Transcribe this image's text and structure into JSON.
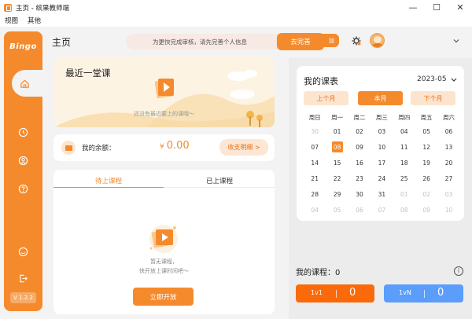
{
  "window": {
    "title": "主页 - 缤果教师端",
    "minimize": "—",
    "maximize": "☐",
    "close": "✕"
  },
  "menu": [
    "视图",
    "其他"
  ],
  "sidebar": {
    "logo": "Bingo",
    "version": "V 1.2.2"
  },
  "header": {
    "title": "主页",
    "notice": "为更快完成审核，请先完善个人信息",
    "notice_button": "去完善",
    "notice_tail": "加"
  },
  "recent": {
    "title": "最近一堂课",
    "empty_text": "还没有最近要上的课哦～"
  },
  "balance": {
    "label": "我的余额：",
    "currency": "¥",
    "value": "0.00",
    "ledger_button": "收支明细 >"
  },
  "courses": {
    "tabs": [
      "待上课程",
      "已上课程"
    ],
    "empty_line1": "暂无课程，",
    "empty_line2": "快开放上课时间吧～",
    "open_button": "立即开放"
  },
  "calendar": {
    "title": "我的课表",
    "month": "2023-05",
    "prev": "上个月",
    "current": "本月",
    "next": "下个月",
    "weekdays": [
      "周日",
      "周一",
      "周二",
      "周三",
      "周四",
      "周五",
      "周六"
    ],
    "weeks": [
      [
        "30",
        "01",
        "02",
        "03",
        "04",
        "05",
        "06"
      ],
      [
        "07",
        "08",
        "09",
        "10",
        "11",
        "12",
        "13"
      ],
      [
        "14",
        "15",
        "16",
        "17",
        "18",
        "19",
        "20"
      ],
      [
        "21",
        "22",
        "23",
        "24",
        "25",
        "26",
        "27"
      ],
      [
        "28",
        "29",
        "30",
        "31",
        "01",
        "02",
        "03"
      ],
      [
        "04",
        "05",
        "06",
        "07",
        "08",
        "09",
        "10"
      ]
    ],
    "today": "08"
  },
  "mycourse": {
    "label": "我的课程：",
    "count": "0",
    "stats": [
      {
        "label": "1v1",
        "value": "0",
        "color": "#fa6a0a"
      },
      {
        "label": "1vN",
        "value": "0",
        "color": "#5b9dfa"
      }
    ]
  },
  "colors": {
    "accent": "#f58a2c",
    "blue": "#5b9dfa"
  }
}
